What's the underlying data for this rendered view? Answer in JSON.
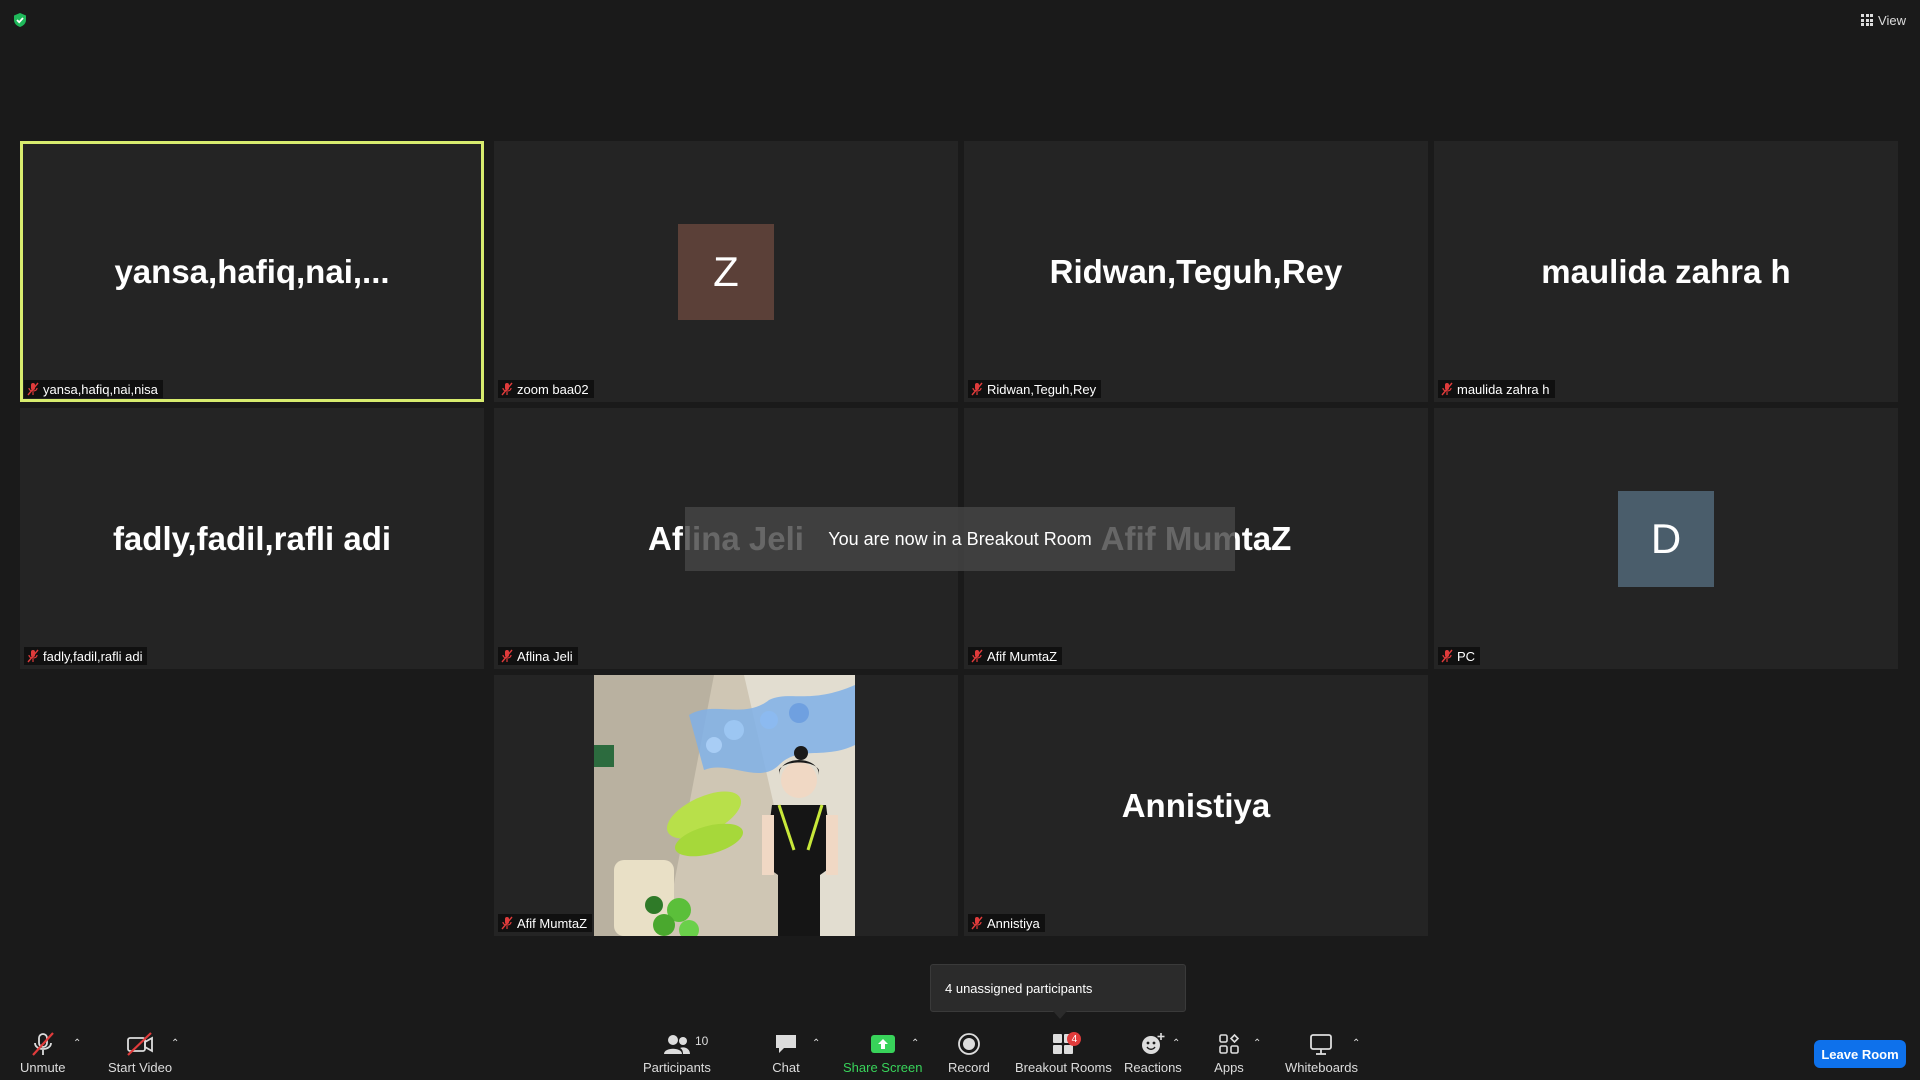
{
  "header": {
    "view_label": "View"
  },
  "tiles": [
    {
      "display": "yansa,hafiq,nai,...",
      "name": "yansa,hafiq,nai,nisa"
    },
    {
      "avatar": "Z",
      "avatar_color": "#5b4038",
      "name": "zoom baa02"
    },
    {
      "display": "Ridwan,Teguh,Rey",
      "name": "Ridwan,Teguh,Rey"
    },
    {
      "display": "maulida zahra h",
      "name": "maulida zahra h"
    },
    {
      "display": "fadly,fadil,rafli adi",
      "name": "fadly,fadil,rafli adi"
    },
    {
      "display": "Aflina Jeli",
      "name": "Aflina Jeli"
    },
    {
      "display": "Afif MumtaZ",
      "name": "Afif MumtaZ"
    },
    {
      "avatar": "D",
      "avatar_color": "#4a5d6b",
      "name": "PC"
    },
    {
      "name": "Afif MumtaZ"
    },
    {
      "display": "Annistiya",
      "name": "Annistiya"
    }
  ],
  "notification": {
    "text": "You are now in a Breakout Room"
  },
  "tooltip": {
    "text": "4 unassigned participants"
  },
  "toolbar": {
    "unmute": "Unmute",
    "start_video": "Start Video",
    "participants": "Participants",
    "participants_count": "10",
    "chat": "Chat",
    "share_screen": "Share Screen",
    "record": "Record",
    "breakout_rooms": "Breakout Rooms",
    "breakout_badge": "4",
    "reactions": "Reactions",
    "apps": "Apps",
    "whiteboards": "Whiteboards",
    "leave": "Leave Room"
  },
  "colors": {
    "active_speaker": "#d8ec6e",
    "share_green": "#38d35a",
    "leave_blue": "#0e71eb",
    "mute_red": "#e03b3b"
  }
}
